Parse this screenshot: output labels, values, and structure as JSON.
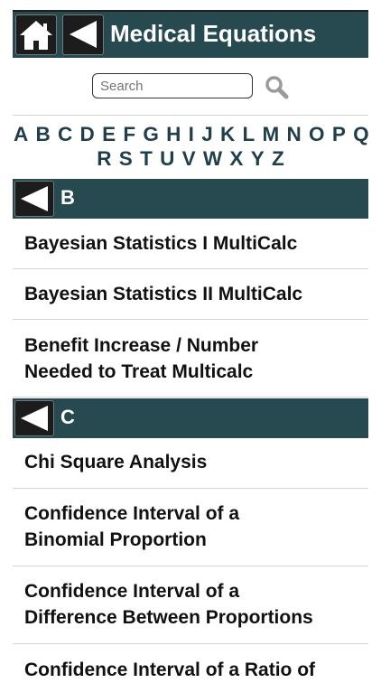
{
  "header": {
    "title": "Medical Equations",
    "home_icon": "home-icon",
    "back_icon": "back-arrow-icon"
  },
  "search": {
    "placeholder": "Search",
    "icon": "search-icon"
  },
  "alphabet": {
    "row1": [
      "A",
      "B",
      "C",
      "D",
      "E",
      "F",
      "G",
      "H",
      "I",
      "J",
      "K",
      "L",
      "M",
      "N",
      "O",
      "P",
      "Q"
    ],
    "row2": [
      "R",
      "S",
      "T",
      "U",
      "V",
      "W",
      "X",
      "Y",
      "Z"
    ]
  },
  "sections": [
    {
      "letter": "B",
      "items": [
        "Bayesian Statistics I MultiCalc",
        "Bayesian Statistics II MultiCalc",
        "Benefit Increase / Number\nNeeded to Treat Multicalc"
      ]
    },
    {
      "letter": "C",
      "items": [
        "Chi Square Analysis",
        "Confidence Interval of a\nBinomial Proportion",
        "Confidence Interval of a\nDifference Between Proportions",
        "Confidence Interval of a Ratio of"
      ]
    }
  ],
  "colors": {
    "header_bg": "#274950",
    "alpha_text": "#203f4a",
    "button_bg": "#1c1c1c"
  }
}
